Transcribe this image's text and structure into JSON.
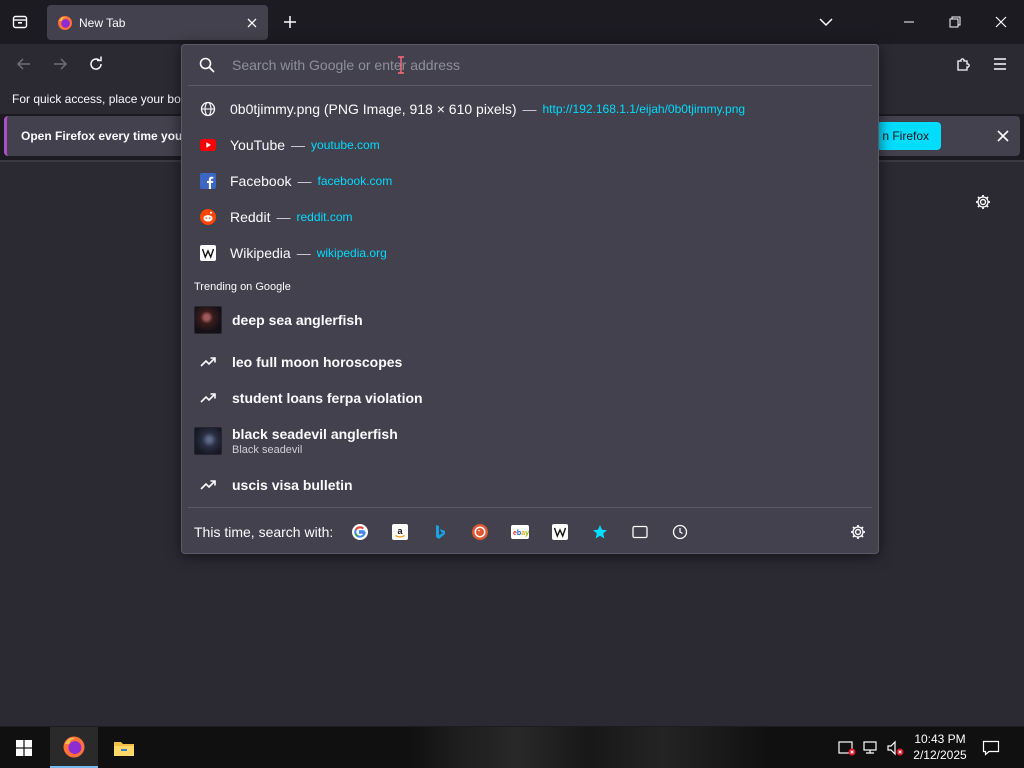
{
  "tab": {
    "title": "New Tab"
  },
  "bookmarks_bar": {
    "text": "For quick access, place your boo"
  },
  "notification": {
    "text": "Open Firefox every time you",
    "button_label": "n Firefox"
  },
  "urlbar": {
    "placeholder": "Search with Google or enter address",
    "results": [
      {
        "icon": "globe-icon",
        "title": "0b0tjimmy.png (PNG Image, 918 × 610 pixels)",
        "dash": "—",
        "url": "http://192.168.1.1/eijah/0b0tjimmy.png"
      },
      {
        "icon": "youtube-icon",
        "title": "YouTube",
        "dash": "—",
        "url": "youtube.com"
      },
      {
        "icon": "facebook-icon",
        "title": "Facebook",
        "dash": "—",
        "url": "facebook.com"
      },
      {
        "icon": "reddit-icon",
        "title": "Reddit",
        "dash": "—",
        "url": "reddit.com"
      },
      {
        "icon": "wikipedia-icon",
        "title": "Wikipedia",
        "dash": "—",
        "url": "wikipedia.org"
      }
    ],
    "trending_label": "Trending on Google",
    "trending": [
      {
        "title": "deep sea anglerfish",
        "subtitle": "",
        "icon": "anglerfish-thumbnail"
      },
      {
        "title": "leo full moon horoscopes",
        "subtitle": "",
        "icon": "trending-icon"
      },
      {
        "title": "student loans ferpa violation",
        "subtitle": "",
        "icon": "trending-icon"
      },
      {
        "title": "black seadevil anglerfish",
        "subtitle": "Black seadevil",
        "icon": "seadevil-thumbnail"
      },
      {
        "title": "uscis visa bulletin",
        "subtitle": "",
        "icon": "trending-icon"
      }
    ],
    "footer_label": "This time, search with:",
    "engines": [
      "google-icon",
      "amazon-icon",
      "bing-icon",
      "duckduckgo-icon",
      "ebay-icon",
      "wikipedia-icon",
      "bookmarks-star-icon",
      "tabs-icon",
      "history-icon"
    ]
  },
  "taskbar": {
    "time": "10:43 PM",
    "date": "2/12/2025"
  },
  "colors": {
    "accent": "#00ddff",
    "panel": "#42414d",
    "background": "#1c1b22",
    "toolbar": "#2b2a33"
  }
}
